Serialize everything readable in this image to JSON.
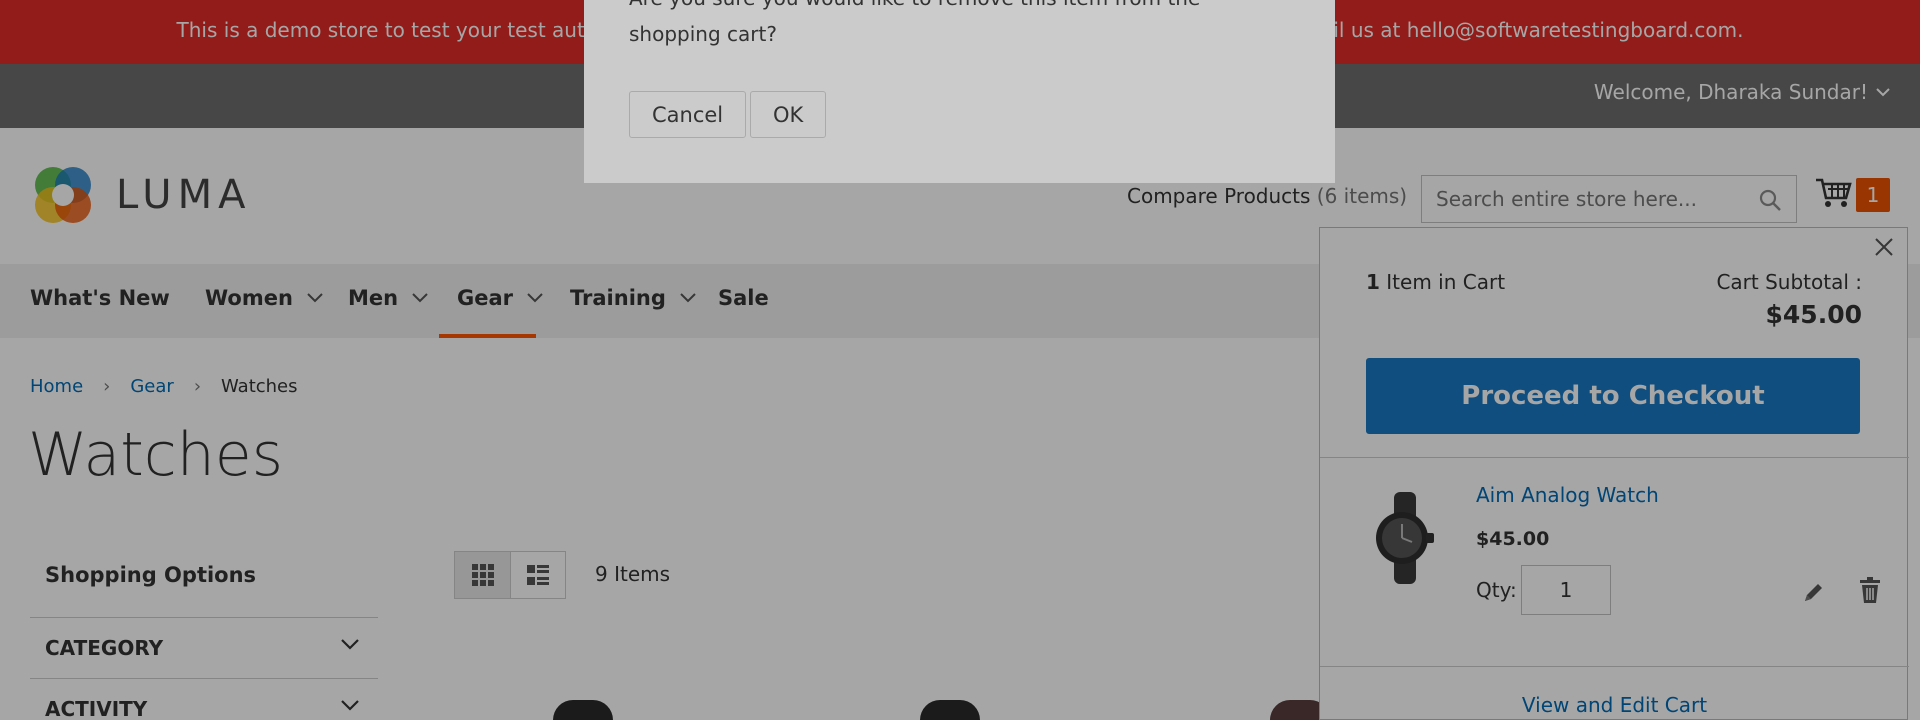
{
  "banner": {
    "text": "This is a demo store to test your test automation scripts. No orders will be fulfilled. If you are facing any issue, email us at hello@softwaretestingboard.com."
  },
  "top_bar": {
    "welcome": "Welcome, Dharaka Sundar!"
  },
  "header": {
    "logo_text": "LUMA",
    "compare_label": "Compare Products",
    "compare_count": "(6 items)",
    "search_placeholder": "Search entire store here...",
    "cart_count": "1"
  },
  "nav": {
    "items": [
      "What's New",
      "Women",
      "Men",
      "Gear",
      "Training",
      "Sale"
    ],
    "active": "Gear",
    "accent": "#ff5501"
  },
  "breadcrumb": {
    "items": [
      "Home",
      "Gear",
      "Watches"
    ]
  },
  "page": {
    "title": "Watches"
  },
  "sidebar": {
    "title": "Shopping Options",
    "filters": [
      "CATEGORY",
      "ACTIVITY"
    ]
  },
  "toolbar": {
    "items_count": "9 Items",
    "modes": [
      "grid-icon",
      "list-icon"
    ]
  },
  "minicart": {
    "items_count": "1",
    "items_label": "Item in Cart",
    "subtotal_label": "Cart Subtotal :",
    "subtotal_value": "$45.00",
    "checkout_label": "Proceed to Checkout",
    "product": {
      "name": "Aim Analog Watch",
      "price": "$45.00",
      "qty_label": "Qty:",
      "qty": "1"
    },
    "view_edit_label": "View and Edit Cart",
    "checkout_color": "#1979c3"
  },
  "modal": {
    "message": "Are you sure you would like to remove this item from the shopping cart?",
    "cancel_label": "Cancel",
    "ok_label": "OK"
  }
}
